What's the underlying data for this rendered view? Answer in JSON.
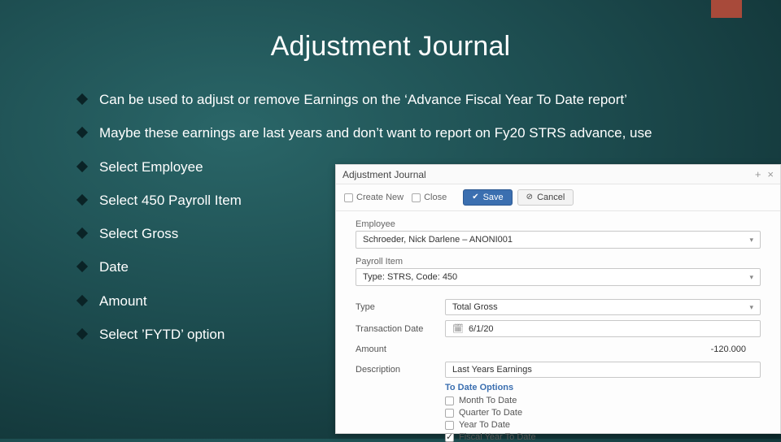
{
  "accent_color": "#a84a3a",
  "title": "Adjustment Journal",
  "bullets": [
    "Can be used to adjust or remove Earnings on the ‘Advance Fiscal Year To Date report’",
    "Maybe these earnings are last years and don’t want to report on Fy20 STRS advance, use",
    "Select Employee",
    "Select 450 Payroll Item",
    "Select Gross",
    "Date",
    "Amount",
    "Select ’FYTD’ option"
  ],
  "form": {
    "header_title": "Adjustment Journal",
    "header_add": "+",
    "header_close": "×",
    "toolbar": {
      "create_new": "Create New",
      "close": "Close",
      "save": "Save",
      "cancel": "Cancel"
    },
    "employee": {
      "label": "Employee",
      "value": "Schroeder, Nick Darlene – ANONI001"
    },
    "payroll_item": {
      "label": "Payroll Item",
      "value": "Type: STRS, Code: 450"
    },
    "rows": {
      "type_label": "Type",
      "type_value": "Total Gross",
      "date_label": "Transaction Date",
      "date_value": "6/1/20",
      "amount_label": "Amount",
      "amount_value": "-120.000",
      "desc_label": "Description",
      "desc_value": "Last Years Earnings"
    },
    "to_date": {
      "header": "To Date Options",
      "opts": [
        "Month To Date",
        "Quarter To Date",
        "Year To Date",
        "Fiscal Year To Date"
      ],
      "checked_index": 3
    }
  }
}
